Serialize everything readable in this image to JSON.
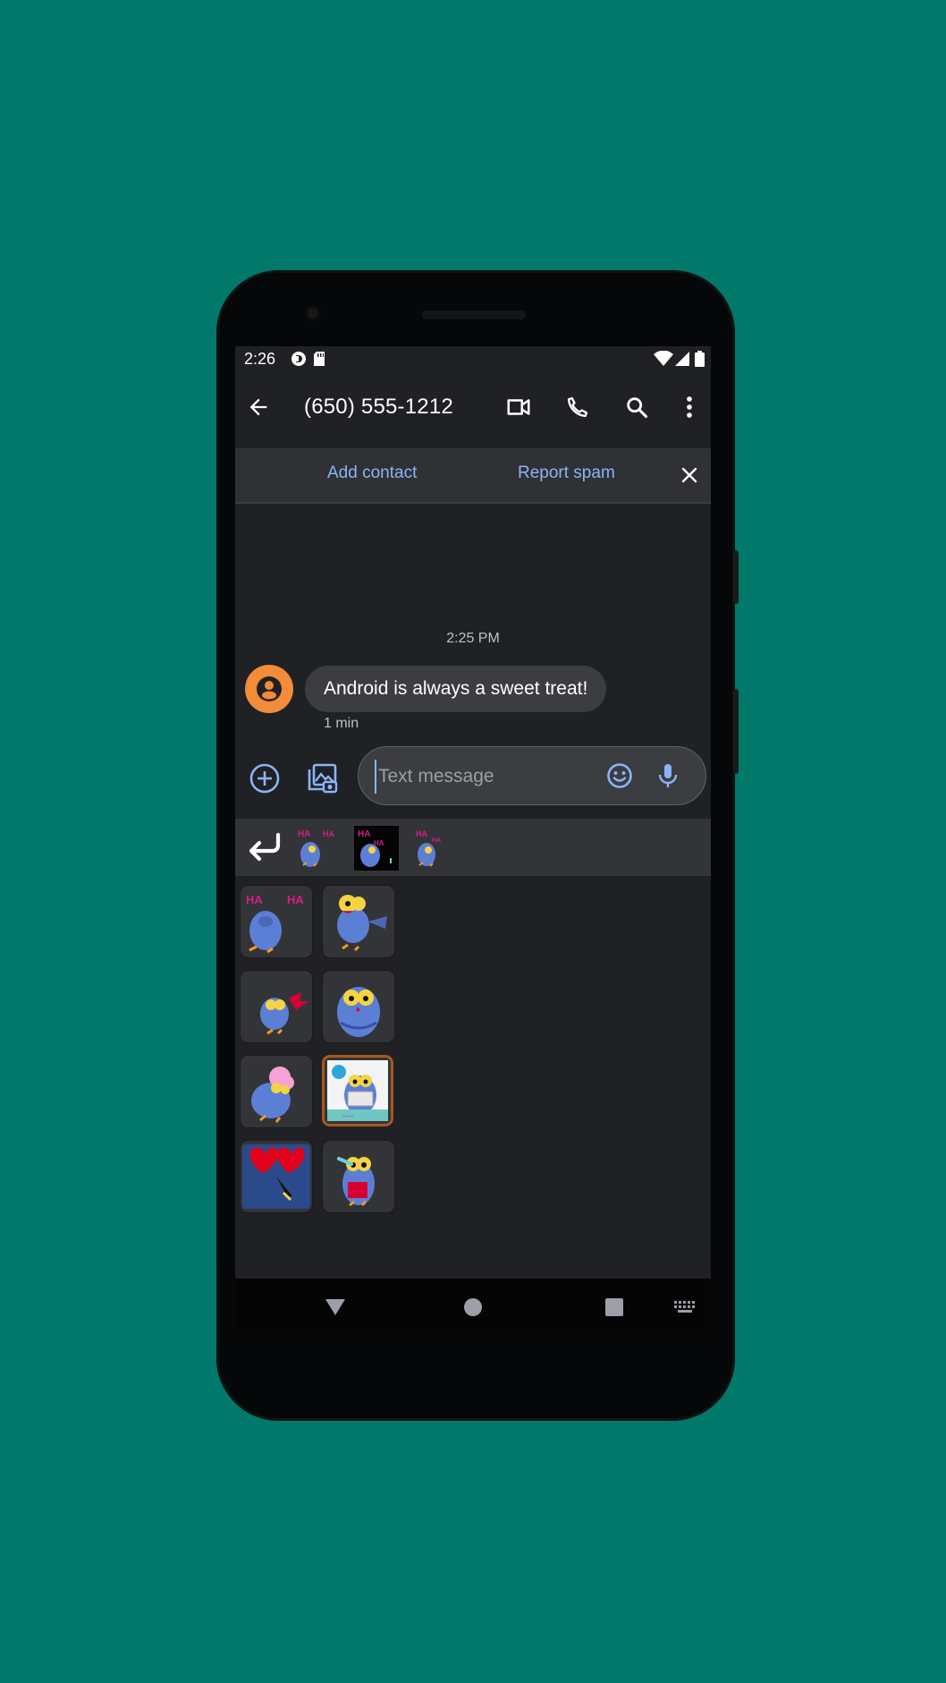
{
  "status": {
    "time": "2:26",
    "left_icons": [
      "cast-icon",
      "sd-card-icon"
    ],
    "right_icons": [
      "wifi-icon",
      "signal-icon",
      "battery-icon"
    ]
  },
  "appbar": {
    "title": "(650) 555-1212",
    "icons": [
      "back-arrow-icon",
      "video-call-icon",
      "phone-icon",
      "search-icon",
      "more-vert-icon"
    ]
  },
  "banner": {
    "add_contact": "Add contact",
    "report_spam": "Report spam"
  },
  "conversation": {
    "timestamp": "2:25 PM",
    "messages": [
      {
        "text": "Android is always a sweet treat!",
        "time": "1 min"
      }
    ]
  },
  "composer": {
    "placeholder": "Text message",
    "value": ""
  },
  "stickers": {
    "tray_count": 3,
    "grid_count": 8
  },
  "colors": {
    "background": "#00786a",
    "screen": "#202124",
    "accent": "#8ab4f8",
    "avatar": "#f28b3a"
  }
}
